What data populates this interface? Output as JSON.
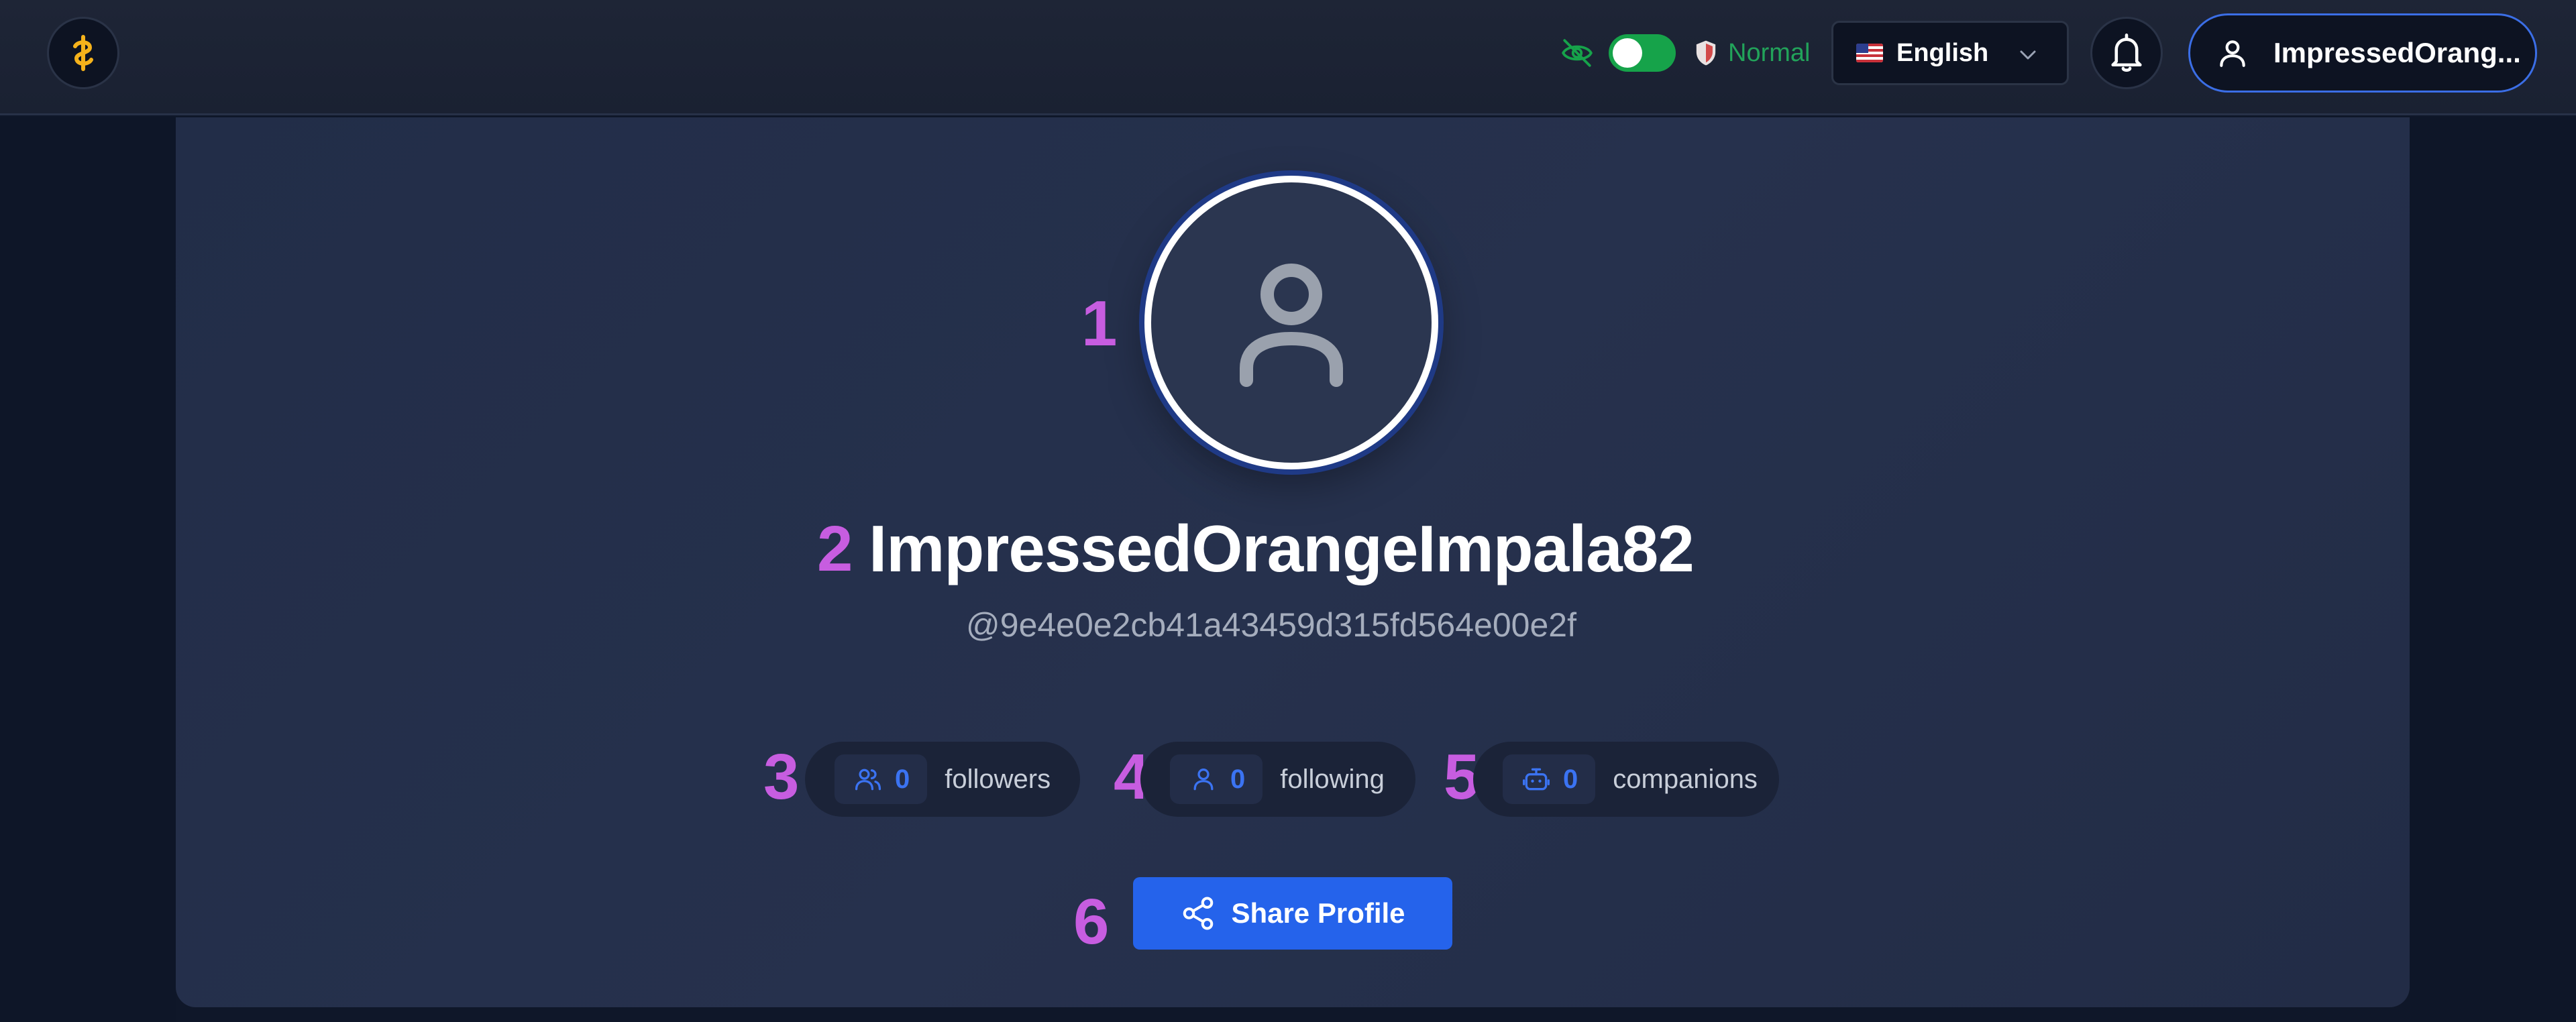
{
  "header": {
    "privacy_mode_label": "Normal",
    "language": {
      "selected": "English",
      "flag": "us-flag-icon"
    },
    "user_menu": {
      "username": "ImpressedOrang..."
    },
    "privacy_toggle_on": true
  },
  "profile": {
    "display_name": "ImpressedOrangeImpala82",
    "handle": "@9e4e0e2cb41a43459d315fd564e00e2f",
    "stats": [
      {
        "count": "0",
        "label": "followers",
        "icon": "users-icon"
      },
      {
        "count": "0",
        "label": "following",
        "icon": "user-icon"
      },
      {
        "count": "0",
        "label": "companions",
        "icon": "bot-icon"
      }
    ],
    "share_label": "Share Profile"
  },
  "markers": [
    "1",
    "2",
    "3",
    "4",
    "5",
    "6"
  ],
  "colors": {
    "accent": "#2563eb",
    "marker": "#c75de0",
    "toggle_on": "#16a34a",
    "logo": "#f5b21b"
  }
}
